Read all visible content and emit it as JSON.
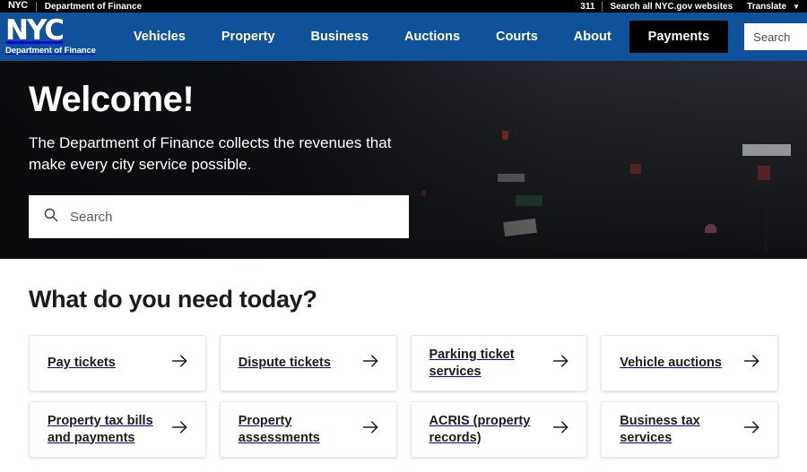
{
  "citybar": {
    "nyc_logo": "NYC",
    "agency": "Department of Finance",
    "phone": "311",
    "search_all": "Search all NYC.gov websites",
    "translate": "Translate",
    "translate_caret": "▼"
  },
  "navbar": {
    "brand_nyc": "NYC",
    "brand_sub": "Department of Finance",
    "links": [
      {
        "label": "Vehicles"
      },
      {
        "label": "Property"
      },
      {
        "label": "Business"
      },
      {
        "label": "Auctions"
      },
      {
        "label": "Courts"
      },
      {
        "label": "About"
      }
    ],
    "payments_label": "Payments",
    "search_placeholder": "Search"
  },
  "hero": {
    "title": "Welcome!",
    "subtitle": "The Department of Finance collects the revenues that make every city service possible.",
    "search_placeholder": "Search"
  },
  "services": {
    "title": "What do you need today?",
    "arrow": "→",
    "cards": [
      {
        "label": "Pay tickets"
      },
      {
        "label": "Dispute tickets"
      },
      {
        "label": "Parking ticket services"
      },
      {
        "label": "Vehicle auctions"
      },
      {
        "label": "Property tax bills and payments"
      },
      {
        "label": "Property assessments"
      },
      {
        "label": "ACRIS (property records)"
      },
      {
        "label": "Business tax services"
      }
    ]
  },
  "colors": {
    "nav_blue": "#0f5299",
    "black": "#000000",
    "text_dark": "#1b1b1b"
  }
}
